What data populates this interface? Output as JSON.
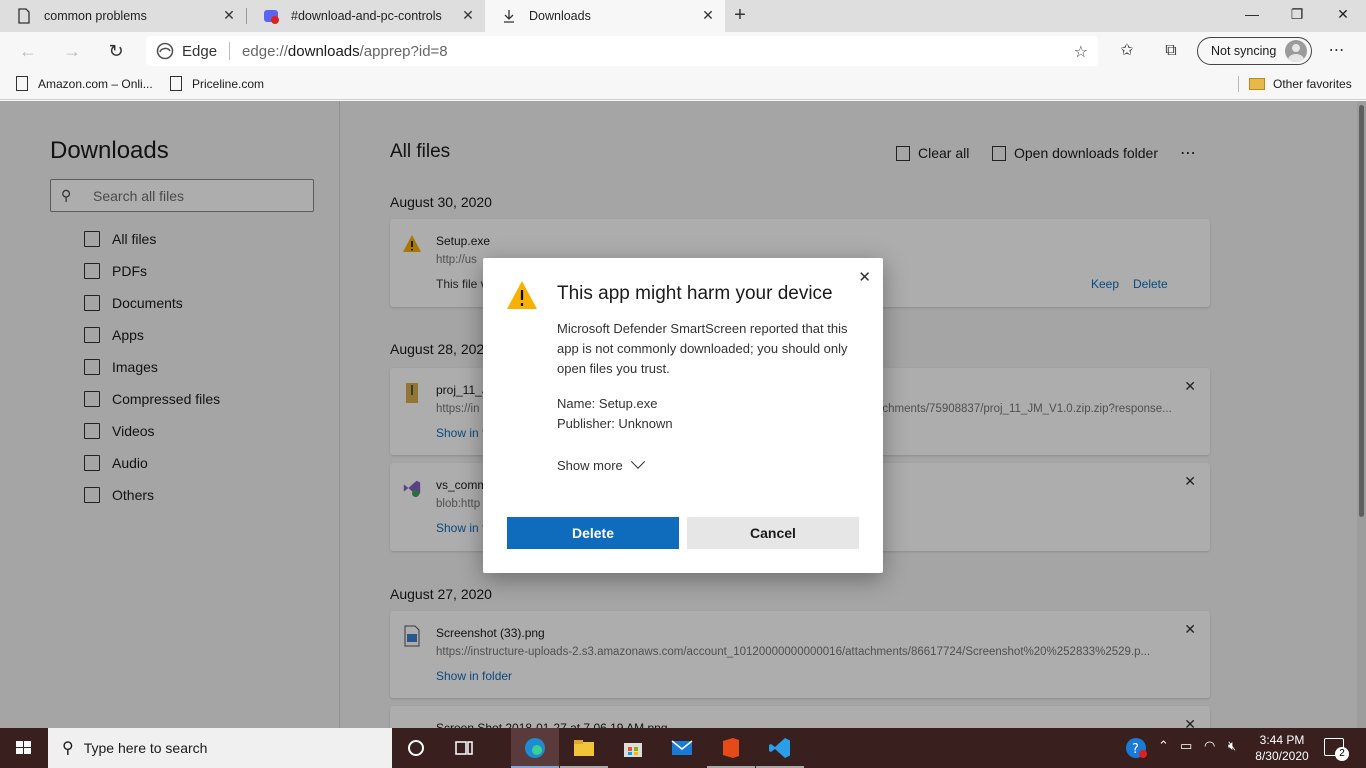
{
  "tabs": [
    {
      "title": "common problems",
      "active": false
    },
    {
      "title": "#download-and-pc-controls",
      "active": false
    },
    {
      "title": "Downloads",
      "active": true
    }
  ],
  "address": {
    "browser_label": "Edge",
    "url_prefix": "edge://",
    "url_host": "downloads",
    "url_path": "/apprep?id=8"
  },
  "sync_label": "Not syncing",
  "favorites": [
    {
      "label": "Amazon.com – Onli..."
    },
    {
      "label": "Priceline.com"
    }
  ],
  "other_favorites": "Other favorites",
  "sidebar": {
    "title": "Downloads",
    "search_placeholder": "Search all files",
    "items": [
      {
        "label": "All files",
        "icon": "grid-icon"
      },
      {
        "label": "PDFs",
        "icon": "pdf-icon"
      },
      {
        "label": "Documents",
        "icon": "document-icon"
      },
      {
        "label": "Apps",
        "icon": "apps-icon"
      },
      {
        "label": "Images",
        "icon": "image-icon"
      },
      {
        "label": "Compressed files",
        "icon": "zip-icon"
      },
      {
        "label": "Videos",
        "icon": "video-icon"
      },
      {
        "label": "Audio",
        "icon": "audio-icon"
      },
      {
        "label": "Others",
        "icon": "other-icon"
      }
    ]
  },
  "main": {
    "title": "All files",
    "clear_all": "Clear all",
    "open_folder": "Open downloads folder",
    "groups": [
      {
        "date": "August 30, 2020",
        "files": [
          {
            "name": "Setup.exe",
            "url": "http://us",
            "warning": "This file v",
            "keep": "Keep",
            "delete": "Delete"
          }
        ]
      },
      {
        "date": "August 28, 202",
        "files": [
          {
            "name": "proj_11_J",
            "url": "https://in",
            "url_tail": "achments/75908837/proj_11_JM_V1.0.zip.zip?response...",
            "link": "Show in f"
          },
          {
            "name": "vs_comm",
            "url": "blob:http",
            "link": "Show in f"
          }
        ]
      },
      {
        "date": "August 27, 2020",
        "files": [
          {
            "name": "Screenshot (33).png",
            "url": "https://instructure-uploads-2.s3.amazonaws.com/account_10120000000000016/attachments/86617724/Screenshot%20%252833%2529.p...",
            "link": "Show in folder"
          },
          {
            "name": "Screen Shot 2018-01-27 at 7.06.19 AM.png"
          }
        ]
      }
    ]
  },
  "dialog": {
    "title": "This app might harm your device",
    "body": "Microsoft Defender SmartScreen reported that this app is not commonly downloaded; you should only open files you trust.",
    "name_line": "Name: Setup.exe",
    "publisher_line": "Publisher: Unknown",
    "show_more": "Show more",
    "delete_label": "Delete",
    "cancel_label": "Cancel"
  },
  "taskbar": {
    "search_placeholder": "Type here to search",
    "time": "3:44 PM",
    "date": "8/30/2020",
    "notifications": "2"
  },
  "colors": {
    "accent": "#0f6cbd",
    "warning": "#f8b100",
    "taskbar": "#3a1f1f"
  }
}
